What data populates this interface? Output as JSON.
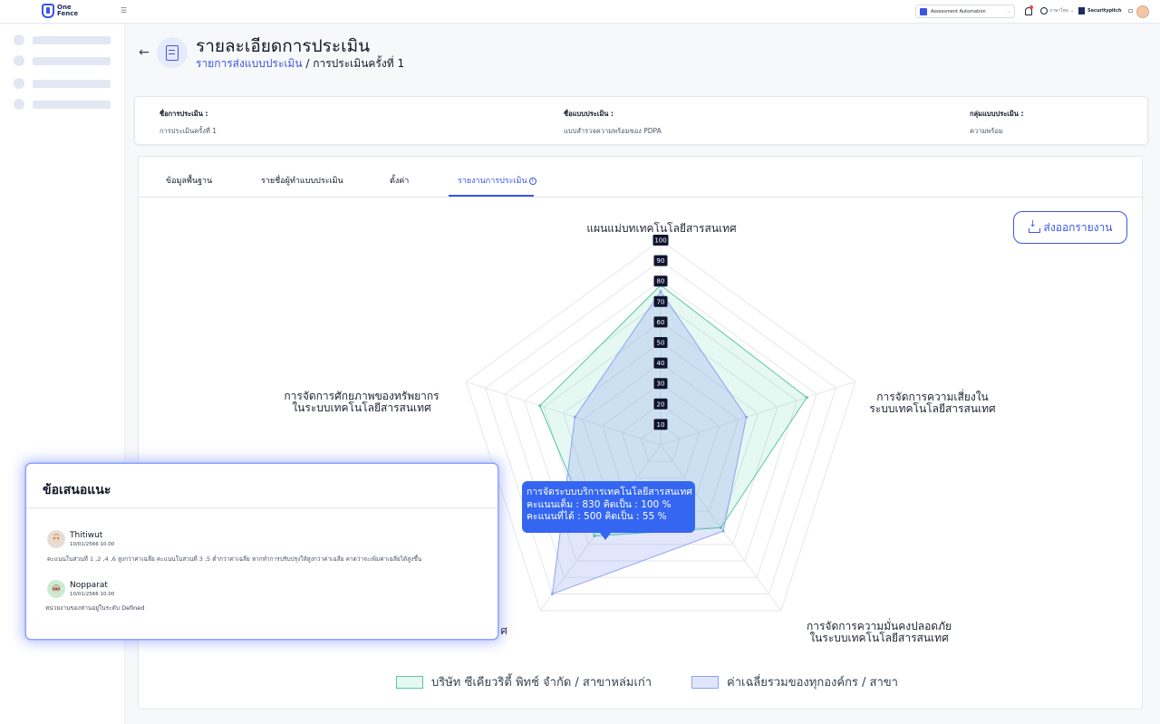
{
  "topbar": {
    "logo_text": "One Fence",
    "org_select_value": "Assessment Automation",
    "language": "ภาษาไทย",
    "company": "Securitypitch"
  },
  "header": {
    "title": "รายละเอียดการประเมิน",
    "breadcrumb_link": "รายการส่งแบบประเมิน",
    "breadcrumb_sep": " / ",
    "breadcrumb_current": "การประเมินครั้งที่ 1"
  },
  "info": [
    {
      "label": "ชื่อการประเมิน :",
      "value": "การประเมินครั้งที่ 1"
    },
    {
      "label": "ชื่อแบบประเมิน :",
      "value": "แบบสำรวจความพร้อมของ PDPA"
    },
    {
      "label": "กลุ่มแบบประเมิน :",
      "value": "ความพร้อม"
    }
  ],
  "tabs": [
    {
      "label": "ข้อมูลพื้นฐาน"
    },
    {
      "label": "รายชื่อผู้ทำแบบประเมิน"
    },
    {
      "label": "ตั้งค่า"
    },
    {
      "label": "รายงานการประเมิน",
      "active": true
    }
  ],
  "export_button": "ส่งออกรายงาน",
  "tooltip": {
    "line1": "การจัดระบบบริการเทคโนโลยีสารสนเทศ",
    "line2": "คะแนนเต็ม : 830 คิดเป็น : 100 %",
    "line3": "คะแนนที่ได้ : 500 คิดเป็น : 55 %"
  },
  "chart_data": {
    "type": "radar",
    "axes": [
      [
        "แผนแม่บทเทคโนโลยีสารสนเทศ"
      ],
      [
        "การจัดการความเสี่ยงใน",
        "ระบบเทคโนโลยีสารสนเทศ"
      ],
      [
        "การจัดการความมั่นคงปลอดภัย",
        "ในระบบเทคโนโลยีสารสนเทศ"
      ],
      [
        "การจัดระบบบริการเทคโนโลยีสารสนเทศ"
      ],
      [
        "การจัดการศักยภาพของทรัพยากร",
        "ในระบบเทคโนโลยีสารสนเทศ"
      ]
    ],
    "axis_label_visible_fragment": "ศ",
    "r_ticks": [
      10,
      20,
      30,
      40,
      50,
      60,
      70,
      80,
      90,
      100
    ],
    "r_range": [
      0,
      100
    ],
    "series": [
      {
        "name": "บริษัท ซีเคียวริตี้ พิทช์ จำกัด / สาขาหล่มเก่า",
        "values": [
          78,
          75,
          50,
          55,
          62
        ],
        "color": "#57c9a0"
      },
      {
        "name": "ค่าเฉลี่ยรวมของทุกองค์กร / สาขา",
        "values": [
          75,
          44,
          52,
          90,
          44
        ],
        "color": "#8ea2f5"
      }
    ]
  },
  "suggestions": {
    "title": "ข้อเสนอแนะ",
    "items": [
      {
        "name": "Thitiwut",
        "date": "10/01/2566 10.00",
        "text": "คะแนนในส่วนที่ 1 ,2 ,4 ,6 สูงกว่าค่าเฉลี่ย คะแนนในส่วนที่ 3 ,5 ต่ำกว่าค่าเฉลี่ย หากทำการปรับปรุงให้สูงกว่าค่าเฉลี่ย คาดว่าจะเพิ่มค่าเฉลี่ยได้สูงขึ้น"
      },
      {
        "name": "Nopparat",
        "date": "10/01/2566 10.00",
        "text_prefix": "หน่วยงานของท่านอยู่ในระดับ ",
        "text_level": "Defined"
      }
    ]
  }
}
